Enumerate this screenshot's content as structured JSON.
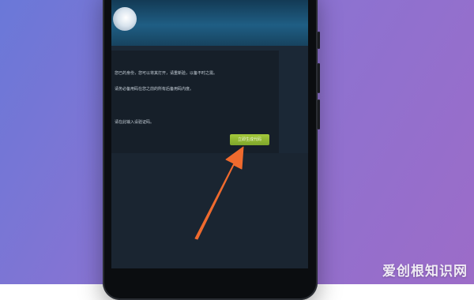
{
  "colors": {
    "accent_button": "#8bb332",
    "arrow": "#ef6a2e",
    "background_start": "#6a78d8",
    "background_end": "#9c6cc8"
  },
  "card": {
    "lines": [
      "您已的身份，您可以将其打开，请重新验，以备不时之需。",
      "请务必备用码在您之前的所有后备用码内度。",
      "请在此输入设验证码。"
    ],
    "action_label": "立即生成代码"
  },
  "icons": {
    "avatar": "avatar-icon",
    "pointer": "arrow-icon"
  },
  "watermark": "爱创根知识网"
}
